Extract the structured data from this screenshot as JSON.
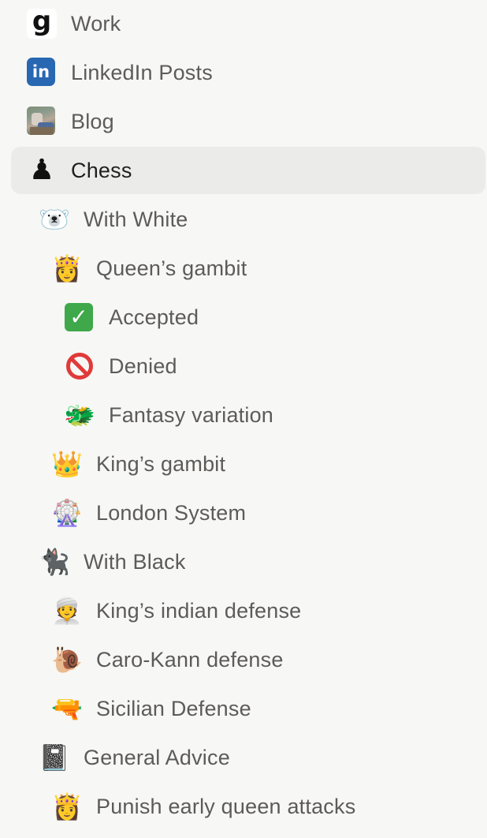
{
  "sidebar": {
    "items": [
      {
        "label": "Work",
        "icon": "g-logo-icon",
        "glyph": "g",
        "level": 0
      },
      {
        "label": "LinkedIn Posts",
        "icon": "linkedin-icon",
        "glyph": "in",
        "level": 0
      },
      {
        "label": "Blog",
        "icon": "photo-thumbnail-icon",
        "glyph": "",
        "level": 0
      },
      {
        "label": "Chess",
        "icon": "chess-pawn-icon",
        "glyph": "♟",
        "level": 0,
        "active": true
      },
      {
        "label": "With White",
        "icon": "polar-bear-icon",
        "glyph": "🐻‍❄️",
        "level": 1
      },
      {
        "label": "Queen’s gambit",
        "icon": "princess-icon",
        "glyph": "👸",
        "level": 2
      },
      {
        "label": "Accepted",
        "icon": "check-mark-icon",
        "glyph": "✓",
        "level": 3
      },
      {
        "label": "Denied",
        "icon": "no-entry-icon",
        "glyph": "",
        "level": 3
      },
      {
        "label": "Fantasy variation",
        "icon": "dragon-face-icon",
        "glyph": "🐲",
        "level": 3
      },
      {
        "label": "King’s gambit",
        "icon": "crown-icon",
        "glyph": "👑",
        "level": 2
      },
      {
        "label": "London System",
        "icon": "ferris-wheel-icon",
        "glyph": "🎡",
        "level": 2
      },
      {
        "label": "With Black",
        "icon": "black-cat-icon",
        "glyph": "🐈‍⬛",
        "level": 1
      },
      {
        "label": "King’s indian defense",
        "icon": "person-turban-icon",
        "glyph": "👳",
        "level": 2
      },
      {
        "label": "Caro-Kann defense",
        "icon": "snail-icon",
        "glyph": "🐌",
        "level": 2
      },
      {
        "label": "Sicilian Defense",
        "icon": "water-pistol-icon",
        "glyph": "🔫",
        "level": 2
      },
      {
        "label": "General Advice",
        "icon": "notebook-icon",
        "glyph": "📓",
        "level": 1
      },
      {
        "label": "Punish early queen attacks",
        "icon": "princess-icon",
        "glyph": "👸",
        "level": 2
      }
    ]
  },
  "colors": {
    "background": "#f7f7f5",
    "active_row": "#ebebe9",
    "text": "#5c5b58",
    "active_text": "#1f1f1d",
    "linkedin": "#2867b2",
    "check": "#3ea84a",
    "no_entry": "#e03a3a"
  }
}
